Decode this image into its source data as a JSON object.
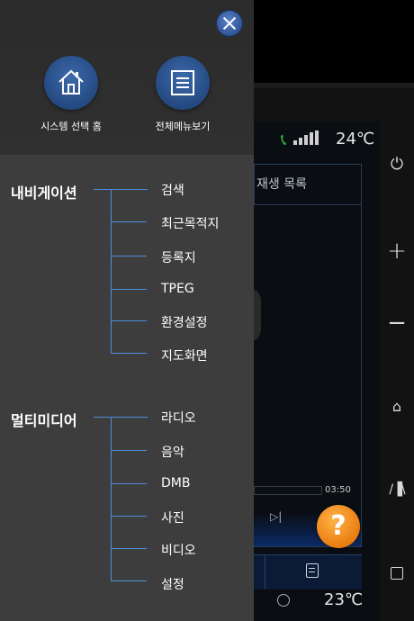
{
  "background": {
    "playlist_label": "재생 목록",
    "temp_top": "24℃",
    "temp_bottom": "23℃",
    "time": "03:50",
    "help_label": "?"
  },
  "menu": {
    "quick_buttons": [
      {
        "label": "시스템 선택 홈",
        "icon": "home-icon"
      },
      {
        "label": "전체메뉴보기",
        "icon": "list-icon"
      }
    ],
    "categories": [
      {
        "label": "내비게이션",
        "items": [
          "검색",
          "최근목적지",
          "등록지",
          "TPEG",
          "환경설정",
          "지도화면"
        ]
      },
      {
        "label": "멀티미디어",
        "items": [
          "라디오",
          "음악",
          "DMB",
          "사진",
          "비디오",
          "설정"
        ]
      }
    ]
  },
  "colors": {
    "accent": "#4d8fdc",
    "panel": "#3d3d3d",
    "button": "#2b4e8f",
    "help": "#f08a1c"
  }
}
